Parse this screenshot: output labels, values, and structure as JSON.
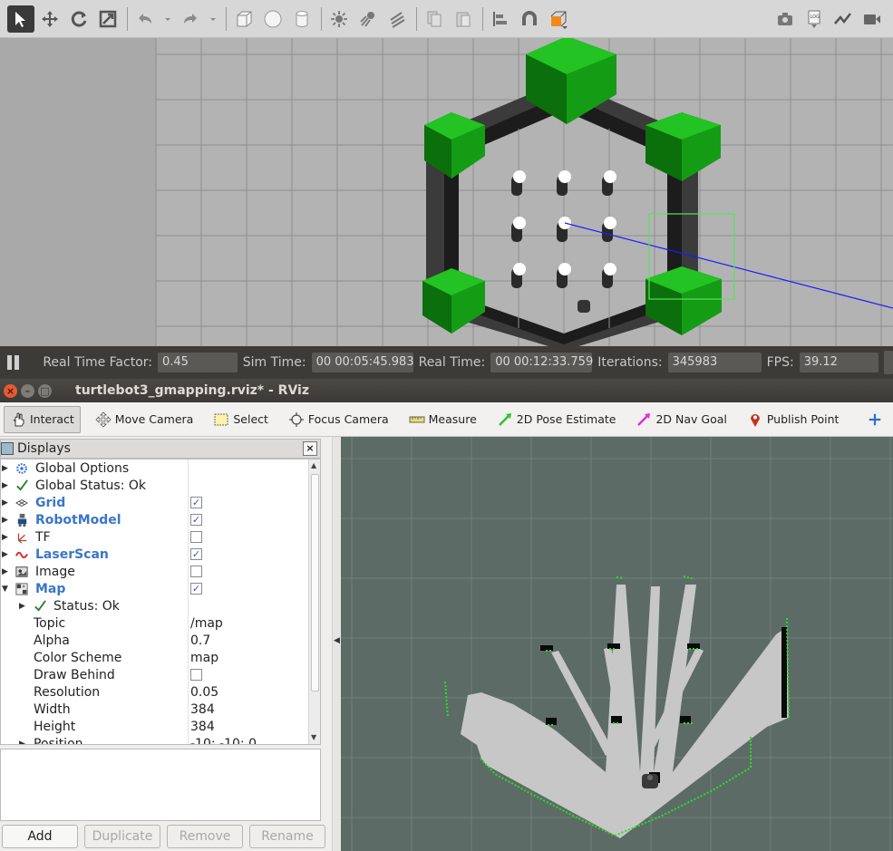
{
  "gazebo": {
    "toolbar": {
      "tools": [
        {
          "icon": "select-arrow-icon",
          "active": true
        },
        {
          "icon": "translate-icon"
        },
        {
          "icon": "rotate-icon"
        },
        {
          "icon": "scale-icon"
        },
        {
          "icon": "undo-icon"
        },
        {
          "icon": "redo-icon"
        },
        {
          "icon": "box-icon"
        },
        {
          "icon": "sphere-icon"
        },
        {
          "icon": "cylinder-icon"
        },
        {
          "icon": "point-light-icon"
        },
        {
          "icon": "spot-light-icon"
        },
        {
          "icon": "directional-light-icon"
        },
        {
          "icon": "copy-icon"
        },
        {
          "icon": "paste-icon"
        },
        {
          "icon": "align-icon"
        },
        {
          "icon": "snap-icon"
        },
        {
          "icon": "view-angle-icon"
        }
      ],
      "right_tools": [
        "screenshot-icon",
        "log-icon",
        "plot-icon",
        "video-icon"
      ]
    },
    "status": {
      "real_time_factor_label": "Real Time Factor:",
      "real_time_factor": "0.45",
      "sim_time_label": "Sim Time:",
      "sim_time": "00 00:05:45.983",
      "real_time_label": "Real Time:",
      "real_time": "00 00:12:33.759",
      "iterations_label": "Iterations:",
      "iterations": "345983",
      "fps_label": "FPS:",
      "fps": "39.12"
    },
    "colors": {
      "ground": "#b3b3b3",
      "walls": "#1c1c1c",
      "trees": "#17a317",
      "selection": "#5ce05c",
      "laser": "#1d1dff"
    }
  },
  "rviz": {
    "window_title": "turtlebot3_gmapping.rviz* - RViz",
    "tools": [
      {
        "label": "Interact",
        "icon": "hand-icon",
        "active": true
      },
      {
        "label": "Move Camera",
        "icon": "move-camera-icon"
      },
      {
        "label": "Select",
        "icon": "select-icon"
      },
      {
        "label": "Focus Camera",
        "icon": "focus-camera-icon"
      },
      {
        "label": "Measure",
        "icon": "ruler-icon"
      },
      {
        "label": "2D Pose Estimate",
        "icon": "green-arrow-icon"
      },
      {
        "label": "2D Nav Goal",
        "icon": "pink-arrow-icon"
      },
      {
        "label": "Publish Point",
        "icon": "map-pin-icon"
      }
    ],
    "displays": {
      "title": "Displays",
      "rows": [
        {
          "name": "Global Options",
          "icon": "gear-icon",
          "arrow": "right",
          "indent": 0
        },
        {
          "name": "Global Status: Ok",
          "icon": "check-icon",
          "arrow": "right",
          "indent": 0
        },
        {
          "name": "Grid",
          "icon": "grid-icon",
          "arrow": "right",
          "indent": 0,
          "blue": true,
          "checked": true
        },
        {
          "name": "RobotModel",
          "icon": "robot-icon",
          "arrow": "right",
          "indent": 0,
          "blue": true,
          "checked": true
        },
        {
          "name": "TF",
          "icon": "tf-icon",
          "arrow": "right",
          "indent": 0,
          "checked": false
        },
        {
          "name": "LaserScan",
          "icon": "laser-icon",
          "arrow": "right",
          "indent": 0,
          "blue": true,
          "checked": true
        },
        {
          "name": "Image",
          "icon": "image-icon",
          "arrow": "right",
          "indent": 0,
          "checked": false
        },
        {
          "name": "Map",
          "icon": "map-icon",
          "arrow": "down",
          "indent": 0,
          "blue": true,
          "checked": true
        },
        {
          "name": "Status: Ok",
          "icon": "check-icon",
          "arrow": "right",
          "indent": 1
        },
        {
          "name": "Topic",
          "indent": 2,
          "value": "/map"
        },
        {
          "name": "Alpha",
          "indent": 2,
          "value": "0.7"
        },
        {
          "name": "Color Scheme",
          "indent": 2,
          "value": "map"
        },
        {
          "name": "Draw Behind",
          "indent": 2,
          "checked": false
        },
        {
          "name": "Resolution",
          "indent": 2,
          "value": "0.05"
        },
        {
          "name": "Width",
          "indent": 2,
          "value": "384"
        },
        {
          "name": "Height",
          "indent": 2,
          "value": "384"
        },
        {
          "name": "Position",
          "indent": 1,
          "arrow": "right",
          "value": "-10; -10; 0"
        }
      ],
      "buttons": [
        {
          "label": "Add",
          "enabled": true
        },
        {
          "label": "Duplicate",
          "enabled": false
        },
        {
          "label": "Remove",
          "enabled": false
        },
        {
          "label": "Rename",
          "enabled": false
        }
      ]
    },
    "colors": {
      "background": "#5c6b65",
      "map_free": "#c7c7c7",
      "map_occupied": "#0a0a0a",
      "scan": "#27e027"
    }
  }
}
